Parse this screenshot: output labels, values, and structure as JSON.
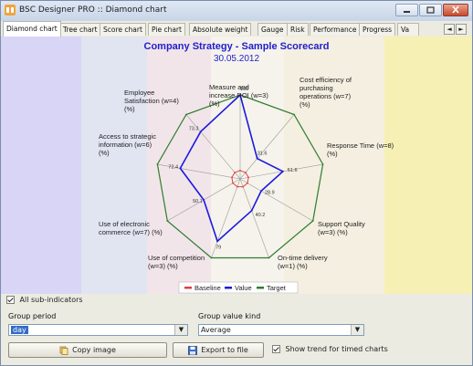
{
  "window": {
    "title": "BSC Designer PRO :: Diamond chart"
  },
  "tabs": [
    {
      "label": "Diamond chart",
      "active": true
    },
    {
      "label": "Tree chart"
    },
    {
      "label": "Score chart"
    },
    {
      "label": "Pie chart"
    },
    {
      "label": "Absolute weight"
    },
    {
      "label": "Gauge"
    },
    {
      "label": "Risk"
    },
    {
      "label": "Performance"
    },
    {
      "label": "Progress"
    },
    {
      "label": "Va"
    }
  ],
  "tab_scroll": {
    "left": "◄",
    "right": "►"
  },
  "chart": {
    "title": "Company Strategy - Sample Scorecard",
    "date": "30.05.2012",
    "colors": {
      "title": "#1f1fcc",
      "value": "#1a1ae0",
      "target": "#2e7d32",
      "baseline": "#e04040"
    },
    "axes": [
      "Measure and increase ROI (w=3) (%)",
      "Cost efficiency of purchasing operations (w=7) (%)",
      "Response Time (w=8) (%)",
      "Support Quality (w=3) (%)",
      "On-time delivery (w=1) (%)",
      "Use of competition (w=3) (%)",
      "Use of electronic commerce (w=7) (%)",
      "Access to strategic information (w=6) (%)",
      "Employee Satisfaction (w=4) (%)"
    ],
    "axis_label_lines": [
      [
        "Measure and",
        "increase ROI (w=3)",
        "(%)"
      ],
      [
        "Cost efficiency of",
        "purchasing",
        "operations (w=7)",
        "(%)"
      ],
      [
        "Response Time (w=8)",
        "(%)"
      ],
      [
        "Support Quality",
        "(w=3) (%)"
      ],
      [
        "On-time delivery",
        "(w=1) (%)"
      ],
      [
        "Use of competition",
        "(w=3) (%)"
      ],
      [
        "Use of electronic",
        "commerce (w=7) (%)"
      ],
      [
        "Access to strategic",
        "information (w=6)",
        "(%)"
      ],
      [
        "Employee",
        "Satisfaction (w=4)",
        "(%)"
      ]
    ],
    "data_labels": [
      "100",
      "31.6",
      "51.6",
      "28.9",
      "40.2",
      "79",
      "50.1",
      "72.4",
      "73.3"
    ],
    "legend": [
      {
        "label": "Baseline",
        "color": "#e04040"
      },
      {
        "label": "Value",
        "color": "#1a1ae0"
      },
      {
        "label": "Target",
        "color": "#2e7d32"
      }
    ]
  },
  "chart_data": {
    "type": "radar",
    "title": "Company Strategy - Sample Scorecard",
    "subtitle": "30.05.2012",
    "categories": [
      "Measure and increase ROI (w=3) (%)",
      "Cost efficiency of purchasing operations (w=7) (%)",
      "Response Time (w=8) (%)",
      "Support Quality (w=3) (%)",
      "On-time delivery (w=1) (%)",
      "Use of competition (w=3) (%)",
      "Use of electronic commerce (w=7) (%)",
      "Access to strategic information (w=6) (%)",
      "Employee Satisfaction (w=4) (%)"
    ],
    "series": [
      {
        "name": "Baseline",
        "values": [
          10,
          10,
          10,
          10,
          10,
          10,
          10,
          10,
          10
        ]
      },
      {
        "name": "Value",
        "values": [
          100,
          31.6,
          51.6,
          28.9,
          40.2,
          79,
          50.1,
          72.4,
          73.3
        ]
      },
      {
        "name": "Target",
        "values": [
          100,
          100,
          100,
          100,
          100,
          100,
          100,
          100,
          100
        ]
      }
    ],
    "ylim": [
      0,
      100
    ],
    "legend_position": "bottom"
  },
  "controls": {
    "all_subindicators": {
      "label": "All sub-indicators",
      "checked": true
    },
    "group_period": {
      "label": "Group period",
      "value": "day"
    },
    "group_value_kind": {
      "label": "Group value kind",
      "value": "Average"
    },
    "copy_image": "Copy image",
    "export_to_file": "Export to file",
    "show_trend": {
      "label": "Show trend for timed charts",
      "checked": true
    }
  }
}
